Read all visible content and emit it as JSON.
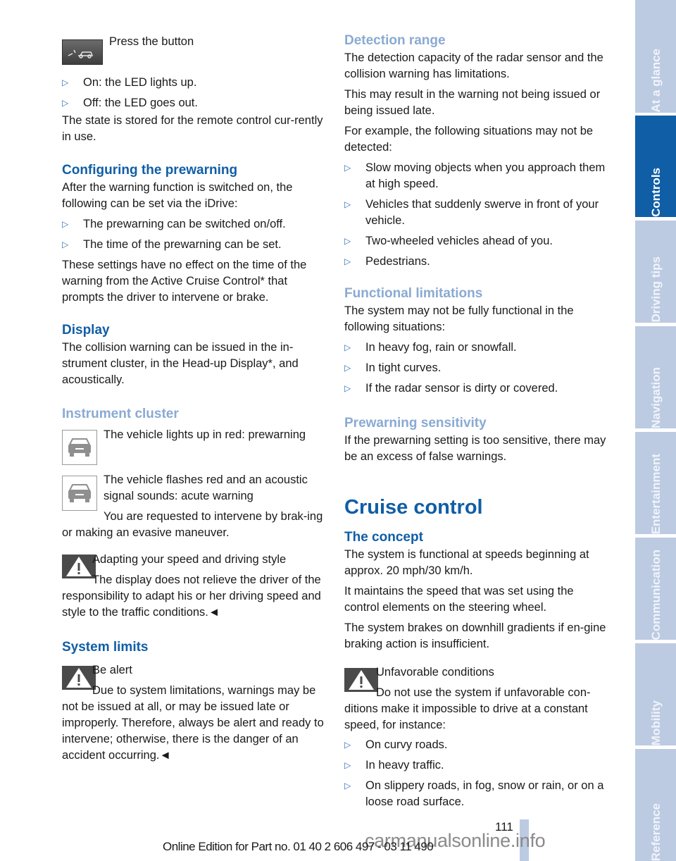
{
  "left_column": {
    "button_caption": "Press the button",
    "on_off_list": [
      "On: the LED lights up.",
      "Off: the LED goes out."
    ],
    "state_text": "The state is stored for the remote control cur-rently in use.",
    "configuring": {
      "heading": "Configuring the prewarning",
      "intro": "After the warning function is switched on, the following can be set via the iDrive:",
      "items": [
        "The prewarning can be switched on/off.",
        "The time of the prewarning can be set."
      ],
      "note": "These settings have no effect on the time of the warning from the Active Cruise Control* that prompts the driver to intervene or brake."
    },
    "display": {
      "heading": "Display",
      "text": "The collision warning can be issued in the in-strument cluster, in the Head-up Display*, and acoustically."
    },
    "instrument_cluster": {
      "heading": "Instrument cluster",
      "prewarning": "The vehicle lights up in red: prewarning",
      "acute": "The vehicle flashes red and an acoustic signal sounds: acute warning",
      "request": "You are requested to intervene by brak-ing or making an evasive maneuver."
    },
    "warning1": {
      "title": "Adapting your speed and driving style",
      "text": "The display does not relieve the driver of the responsibility to adapt his or her driving speed and style to the traffic conditions.◄"
    },
    "system_limits": {
      "heading": "System limits",
      "warning_title": "Be alert",
      "warning_text": "Due to system limitations, warnings may be not be issued at all, or may be issued late or improperly. Therefore, always be alert and ready to intervene; otherwise, there is the danger of an accident occurring.◄"
    }
  },
  "right_column": {
    "detection": {
      "heading": "Detection range",
      "p1": "The detection capacity of the radar sensor and the collision warning has limitations.",
      "p2": "This may result in the warning not being issued or being issued late.",
      "p3": "For example, the following situations may not be detected:",
      "items": [
        "Slow moving objects when you approach them at high speed.",
        "Vehicles that suddenly swerve in front of your vehicle.",
        "Two-wheeled vehicles ahead of you.",
        "Pedestrians."
      ]
    },
    "functional": {
      "heading": "Functional limitations",
      "intro": "The system may not be fully functional in the following situations:",
      "items": [
        "In heavy fog, rain or snowfall.",
        "In tight curves.",
        "If the radar sensor is dirty or covered."
      ]
    },
    "sensitivity": {
      "heading": "Prewarning sensitivity",
      "text": "If the prewarning setting is too sensitive, there may be an excess of false warnings."
    },
    "cruise": {
      "title": "Cruise control",
      "concept_heading": "The concept",
      "p1": "The system is functional at speeds beginning at approx. 20 mph/30 km/h.",
      "p2": "It maintains the speed that was set using the control elements on the steering wheel.",
      "p3": "The system brakes on downhill gradients if en-gine braking action is insufficient.",
      "warning_title": "Unfavorable conditions",
      "warning_text": "Do not use the system if unfavorable con-ditions make it impossible to drive at a constant speed, for instance:",
      "items": [
        "On curvy roads.",
        "In heavy traffic.",
        "On slippery roads, in fog, snow or rain, or on a loose road surface."
      ]
    }
  },
  "bullet_glyph": "▷",
  "sidebar": {
    "tabs": [
      "At a glance",
      "Controls",
      "Driving tips",
      "Navigation",
      "Entertainment",
      "Communication",
      "Mobility",
      "Reference"
    ],
    "active": "Controls"
  },
  "footer": {
    "page_number": "111",
    "edition": "Online Edition for Part no. 01 40 2 606 497 - 03 11 490",
    "watermark": "carmanualsonline.info"
  },
  "colors": {
    "heading_dark": "#0f5ea6",
    "heading_light": "#8aaad3",
    "sidebar_inactive": "#bccbe2",
    "sidebar_active": "#0f5ea6"
  }
}
